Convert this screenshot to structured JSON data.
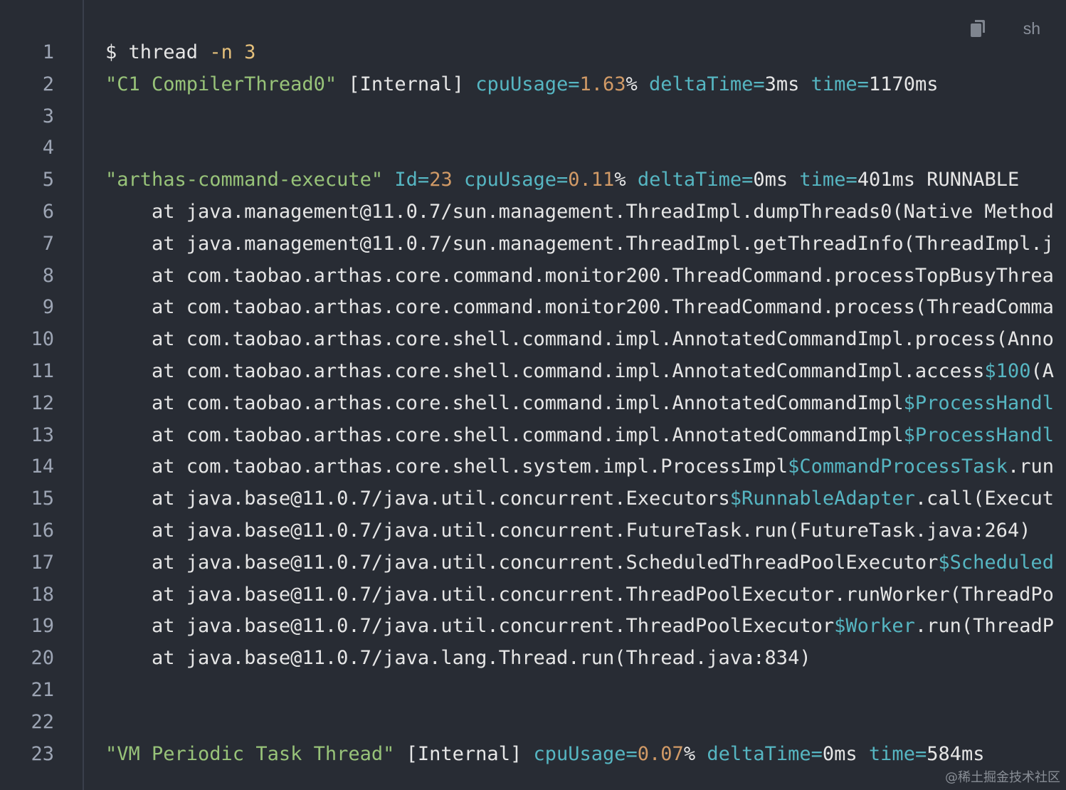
{
  "toolbar": {
    "copy_icon": "copy-icon",
    "language": "sh"
  },
  "watermark": "@稀土掘金技术社区",
  "colors": {
    "background": "#282c34",
    "plain": "#e6e6e6",
    "string": "#98c379",
    "flag": "#e5c07b",
    "attr": "#56b6c2",
    "number": "#d19a66",
    "line_number": "#9da5b4"
  },
  "lines": [
    {
      "n": "1",
      "tokens": [
        {
          "t": "$ thread ",
          "c": "plain"
        },
        {
          "t": "-n",
          "c": "flag"
        },
        {
          "t": " ",
          "c": "plain"
        },
        {
          "t": "3",
          "c": "flag"
        }
      ]
    },
    {
      "n": "2",
      "tokens": [
        {
          "t": "\"C1 CompilerThread0\"",
          "c": "string"
        },
        {
          "t": " [Internal] ",
          "c": "plain"
        },
        {
          "t": "cpuUsage=",
          "c": "attr"
        },
        {
          "t": "1.63",
          "c": "num"
        },
        {
          "t": "% ",
          "c": "plain"
        },
        {
          "t": "deltaTime=",
          "c": "attr"
        },
        {
          "t": "3ms ",
          "c": "plain"
        },
        {
          "t": "time=",
          "c": "attr"
        },
        {
          "t": "1170ms",
          "c": "plain"
        }
      ]
    },
    {
      "n": "3",
      "tokens": []
    },
    {
      "n": "4",
      "tokens": []
    },
    {
      "n": "5",
      "tokens": [
        {
          "t": "\"arthas-command-execute\"",
          "c": "string"
        },
        {
          "t": " ",
          "c": "plain"
        },
        {
          "t": "Id=",
          "c": "attr"
        },
        {
          "t": "23",
          "c": "num"
        },
        {
          "t": " ",
          "c": "plain"
        },
        {
          "t": "cpuUsage=",
          "c": "attr"
        },
        {
          "t": "0.11",
          "c": "num"
        },
        {
          "t": "% ",
          "c": "plain"
        },
        {
          "t": "deltaTime=",
          "c": "attr"
        },
        {
          "t": "0ms ",
          "c": "plain"
        },
        {
          "t": "time=",
          "c": "attr"
        },
        {
          "t": "401ms RUNNABLE",
          "c": "plain"
        }
      ]
    },
    {
      "n": "6",
      "tokens": [
        {
          "t": "    at java.management@11.0.7/sun.management.ThreadImpl.dumpThreads0(Native Method",
          "c": "plain"
        }
      ]
    },
    {
      "n": "7",
      "tokens": [
        {
          "t": "    at java.management@11.0.7/sun.management.ThreadImpl.getThreadInfo(ThreadImpl.j",
          "c": "plain"
        }
      ]
    },
    {
      "n": "8",
      "tokens": [
        {
          "t": "    at com.taobao.arthas.core.command.monitor200.ThreadCommand.processTopBusyThrea",
          "c": "plain"
        }
      ]
    },
    {
      "n": "9",
      "tokens": [
        {
          "t": "    at com.taobao.arthas.core.command.monitor200.ThreadCommand.process(ThreadComma",
          "c": "plain"
        }
      ]
    },
    {
      "n": "10",
      "tokens": [
        {
          "t": "    at com.taobao.arthas.core.shell.command.impl.AnnotatedCommandImpl.process(Anno",
          "c": "plain"
        }
      ]
    },
    {
      "n": "11",
      "tokens": [
        {
          "t": "    at com.taobao.arthas.core.shell.command.impl.AnnotatedCommandImpl.access",
          "c": "plain"
        },
        {
          "t": "$100",
          "c": "var"
        },
        {
          "t": "(A",
          "c": "plain"
        }
      ]
    },
    {
      "n": "12",
      "tokens": [
        {
          "t": "    at com.taobao.arthas.core.shell.command.impl.AnnotatedCommandImpl",
          "c": "plain"
        },
        {
          "t": "$ProcessHandl",
          "c": "var"
        }
      ]
    },
    {
      "n": "13",
      "tokens": [
        {
          "t": "    at com.taobao.arthas.core.shell.command.impl.AnnotatedCommandImpl",
          "c": "plain"
        },
        {
          "t": "$ProcessHandl",
          "c": "var"
        }
      ]
    },
    {
      "n": "14",
      "tokens": [
        {
          "t": "    at com.taobao.arthas.core.shell.system.impl.ProcessImpl",
          "c": "plain"
        },
        {
          "t": "$CommandProcessTask",
          "c": "var"
        },
        {
          "t": ".run",
          "c": "plain"
        }
      ]
    },
    {
      "n": "15",
      "tokens": [
        {
          "t": "    at java.base@11.0.7/java.util.concurrent.Executors",
          "c": "plain"
        },
        {
          "t": "$RunnableAdapter",
          "c": "var"
        },
        {
          "t": ".call(Execut",
          "c": "plain"
        }
      ]
    },
    {
      "n": "16",
      "tokens": [
        {
          "t": "    at java.base@11.0.7/java.util.concurrent.FutureTask.run(FutureTask.java:264)",
          "c": "plain"
        }
      ]
    },
    {
      "n": "17",
      "tokens": [
        {
          "t": "    at java.base@11.0.7/java.util.concurrent.ScheduledThreadPoolExecutor",
          "c": "plain"
        },
        {
          "t": "$Scheduled",
          "c": "var"
        }
      ]
    },
    {
      "n": "18",
      "tokens": [
        {
          "t": "    at java.base@11.0.7/java.util.concurrent.ThreadPoolExecutor.runWorker(ThreadPo",
          "c": "plain"
        }
      ]
    },
    {
      "n": "19",
      "tokens": [
        {
          "t": "    at java.base@11.0.7/java.util.concurrent.ThreadPoolExecutor",
          "c": "plain"
        },
        {
          "t": "$Worker",
          "c": "var"
        },
        {
          "t": ".run(ThreadP",
          "c": "plain"
        }
      ]
    },
    {
      "n": "20",
      "tokens": [
        {
          "t": "    at java.base@11.0.7/java.lang.Thread.run(Thread.java:834)",
          "c": "plain"
        }
      ]
    },
    {
      "n": "21",
      "tokens": []
    },
    {
      "n": "22",
      "tokens": []
    },
    {
      "n": "23",
      "tokens": [
        {
          "t": "\"VM Periodic Task Thread\"",
          "c": "string"
        },
        {
          "t": " [Internal] ",
          "c": "plain"
        },
        {
          "t": "cpuUsage=",
          "c": "attr"
        },
        {
          "t": "0.07",
          "c": "num"
        },
        {
          "t": "% ",
          "c": "plain"
        },
        {
          "t": "deltaTime=",
          "c": "attr"
        },
        {
          "t": "0ms ",
          "c": "plain"
        },
        {
          "t": "time=",
          "c": "attr"
        },
        {
          "t": "584ms",
          "c": "plain"
        }
      ]
    }
  ]
}
